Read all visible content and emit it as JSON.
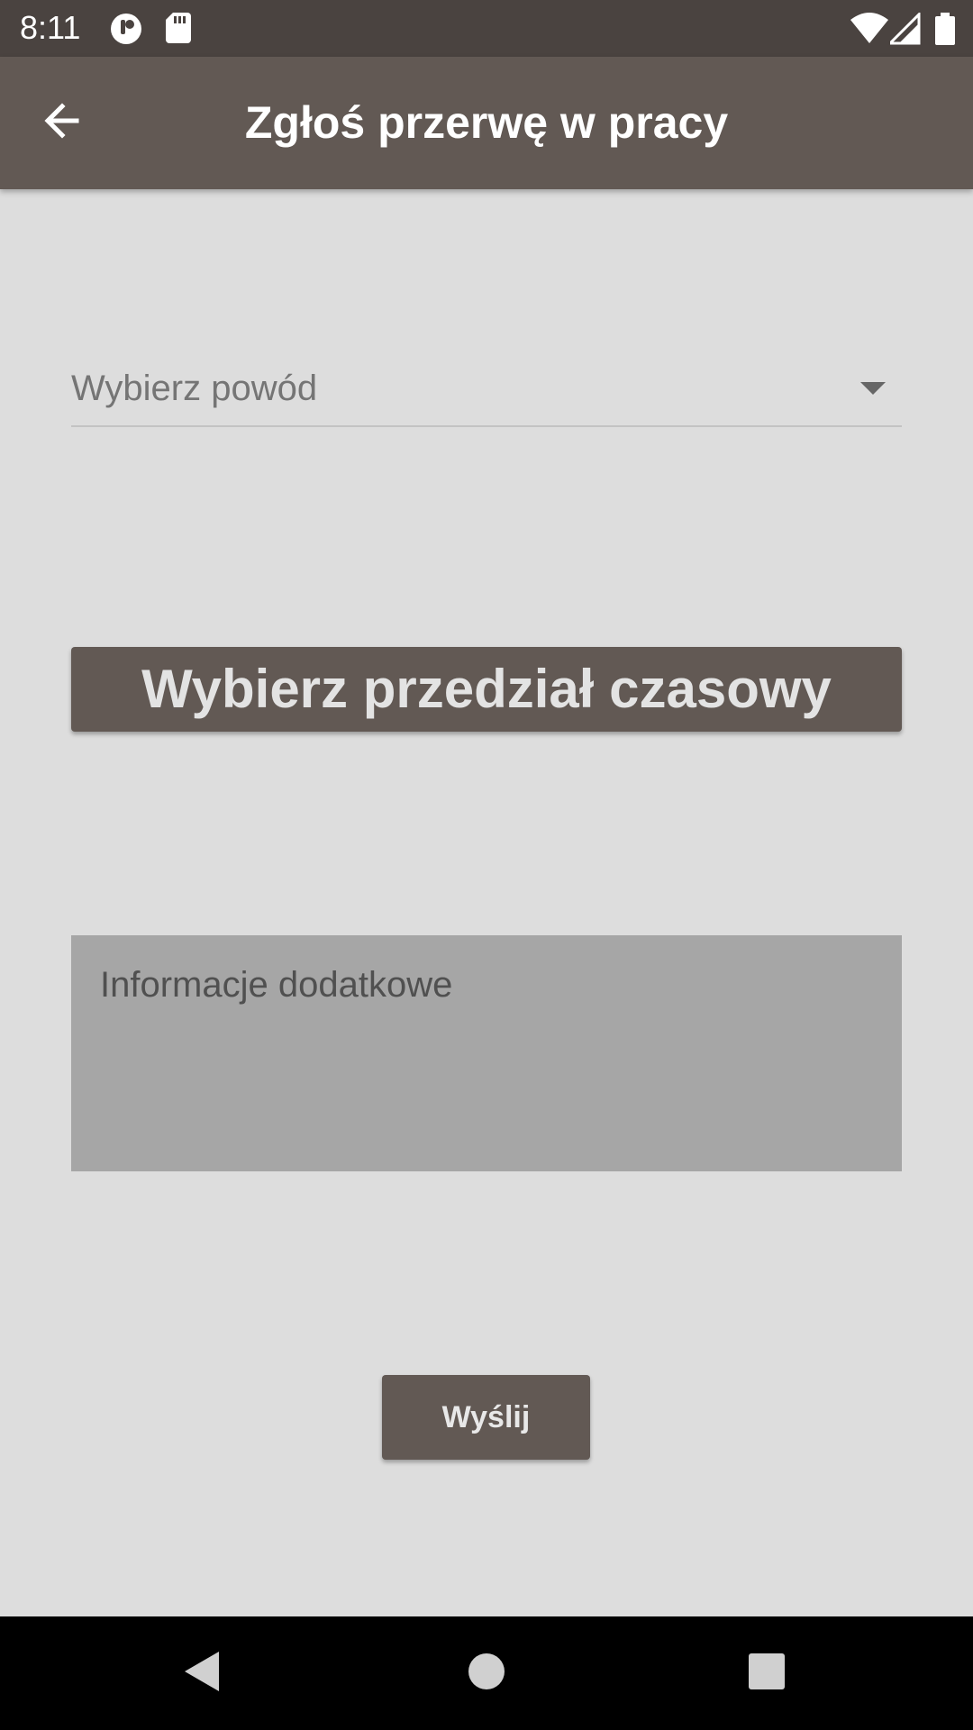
{
  "status_bar": {
    "time": "8:11",
    "left_icons": [
      "app-notification-icon",
      "sd-card-icon"
    ],
    "right_icons": [
      "wifi-icon",
      "cell-signal-icon",
      "battery-icon"
    ]
  },
  "app_bar": {
    "title": "Zgłoś przerwę w pracy",
    "back_icon": "arrow-back-icon"
  },
  "form": {
    "reason_dropdown": {
      "placeholder": "Wybierz powód",
      "icon": "dropdown-arrow-icon"
    },
    "time_range_button_label": "Wybierz przedział czasowy",
    "additional_info_placeholder": "Informacje dodatkowe",
    "send_button_label": "Wyślij"
  },
  "nav_bar": {
    "icons": [
      "back-triangle-icon",
      "home-circle-icon",
      "recents-square-icon"
    ]
  },
  "colors": {
    "status_bar": "#4a4340",
    "app_bar": "#625954",
    "background": "#dddddd",
    "button": "#625954",
    "textarea": "#a6a6a6",
    "nav_bar": "#000000"
  }
}
